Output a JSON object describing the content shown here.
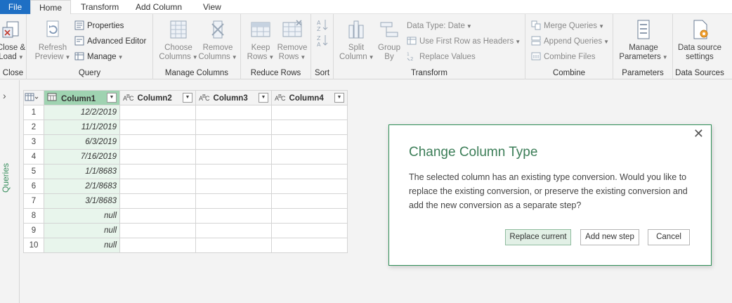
{
  "tabs": {
    "file": "File",
    "home": "Home",
    "transform": "Transform",
    "add_column": "Add Column",
    "view": "View"
  },
  "ribbon": {
    "close_group": {
      "label": "Close",
      "close_load_line1": "Close &",
      "close_load_line2": "Load"
    },
    "query_group": {
      "label": "Query",
      "refresh_line1": "Refresh",
      "refresh_line2": "Preview",
      "properties": "Properties",
      "advanced_editor": "Advanced Editor",
      "manage": "Manage"
    },
    "manage_columns_group": {
      "label": "Manage Columns",
      "choose_line1": "Choose",
      "choose_line2": "Columns",
      "remove_line1": "Remove",
      "remove_line2": "Columns"
    },
    "reduce_rows_group": {
      "label": "Reduce Rows",
      "keep_line1": "Keep",
      "keep_line2": "Rows",
      "remove_line1": "Remove",
      "remove_line2": "Rows"
    },
    "sort_group": {
      "label": "Sort"
    },
    "transform_group": {
      "label": "Transform",
      "split_line1": "Split",
      "split_line2": "Column",
      "group_line1": "Group",
      "group_line2": "By",
      "data_type": "Data Type: Date",
      "use_first_row": "Use First Row as Headers",
      "replace_values": "Replace Values"
    },
    "combine_group": {
      "label": "Combine",
      "merge_queries": "Merge Queries",
      "append_queries": "Append Queries",
      "combine_files": "Combine Files"
    },
    "parameters_group": {
      "label": "Parameters",
      "manage_line1": "Manage",
      "manage_line2": "Parameters"
    },
    "data_sources_group": {
      "label": "Data Sources",
      "settings_line1": "Data source",
      "settings_line2": "settings"
    }
  },
  "queries_pane": {
    "label": "Queries"
  },
  "grid": {
    "columns": [
      {
        "name": "Column1",
        "type_icon": "calendar-icon"
      },
      {
        "name": "Column2",
        "type_icon": "ABC"
      },
      {
        "name": "Column3",
        "type_icon": "ABC"
      },
      {
        "name": "Column4",
        "type_icon": "ABC"
      }
    ],
    "rows": [
      {
        "num": "1",
        "c1": "12/2/2019"
      },
      {
        "num": "2",
        "c1": "11/1/2019"
      },
      {
        "num": "3",
        "c1": "6/3/2019"
      },
      {
        "num": "4",
        "c1": "7/16/2019"
      },
      {
        "num": "5",
        "c1": "1/1/8683"
      },
      {
        "num": "6",
        "c1": "2/1/8683"
      },
      {
        "num": "7",
        "c1": "3/1/8683"
      },
      {
        "num": "8",
        "c1": "null"
      },
      {
        "num": "9",
        "c1": "null"
      },
      {
        "num": "10",
        "c1": "null"
      }
    ]
  },
  "dialog": {
    "title": "Change Column Type",
    "message": "The selected column has an existing type conversion. Would you like to replace the existing conversion, or preserve the existing conversion and add the new conversion as a separate step?",
    "replace_button": "Replace current",
    "add_step_button": "Add new step",
    "cancel_button": "Cancel",
    "close_glyph": "✕"
  },
  "colors": {
    "file_tab": "#1e6fc4",
    "selected_column": "#9fd3b1",
    "dialog_title": "#3b7d57",
    "dialog_border": "#2f8f57"
  }
}
